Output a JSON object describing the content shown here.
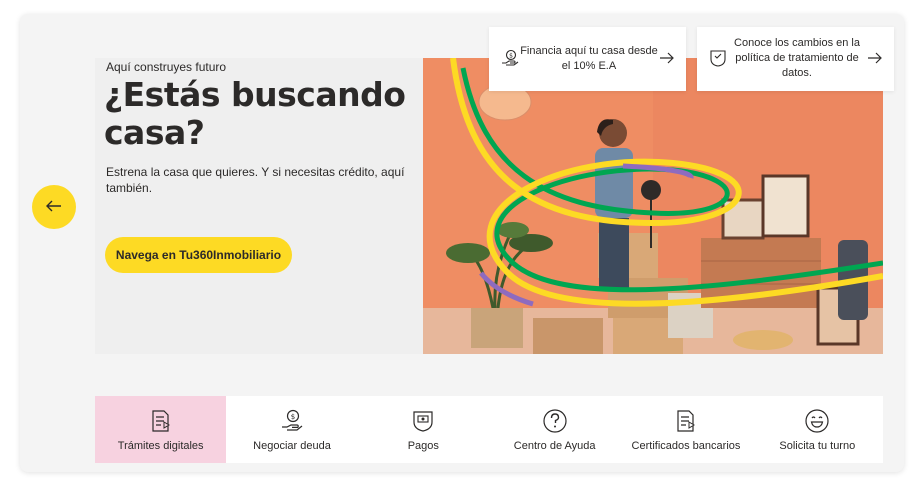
{
  "hero": {
    "eyebrow": "Aquí construyes futuro",
    "headline": "¿Estás buscando casa?",
    "description": "Estrena la casa que quieres. Y si necesitas crédito, aquí también.",
    "cta_label": "Navega en Tu360Inmobiliario"
  },
  "promos": [
    {
      "text": "Financia aquí tu casa desde el 10% E.A",
      "icon": "money-hand-icon"
    },
    {
      "text": "Conoce los cambios en la política de tratamiento de datos.",
      "icon": "shield-document-icon"
    }
  ],
  "shortcuts": [
    {
      "label": "Trámites digitales",
      "icon": "document-icon",
      "active": true
    },
    {
      "label": "Negociar deuda",
      "icon": "money-hand-icon",
      "active": false
    },
    {
      "label": "Pagos",
      "icon": "payment-icon",
      "active": false
    },
    {
      "label": "Centro de Ayuda",
      "icon": "question-circle-icon",
      "active": false
    },
    {
      "label": "Certificados bancarios",
      "icon": "document-icon",
      "active": false
    },
    {
      "label": "Solicita tu turno",
      "icon": "smiley-icon",
      "active": false
    }
  ],
  "colors": {
    "accent_yellow": "#fdda24",
    "active_pink": "#f7d2e0",
    "photo_orange": "#ef8d63",
    "text_dark": "#2c2a29",
    "stripe_green": "#00a651",
    "stripe_purple": "#8e6bbf"
  }
}
